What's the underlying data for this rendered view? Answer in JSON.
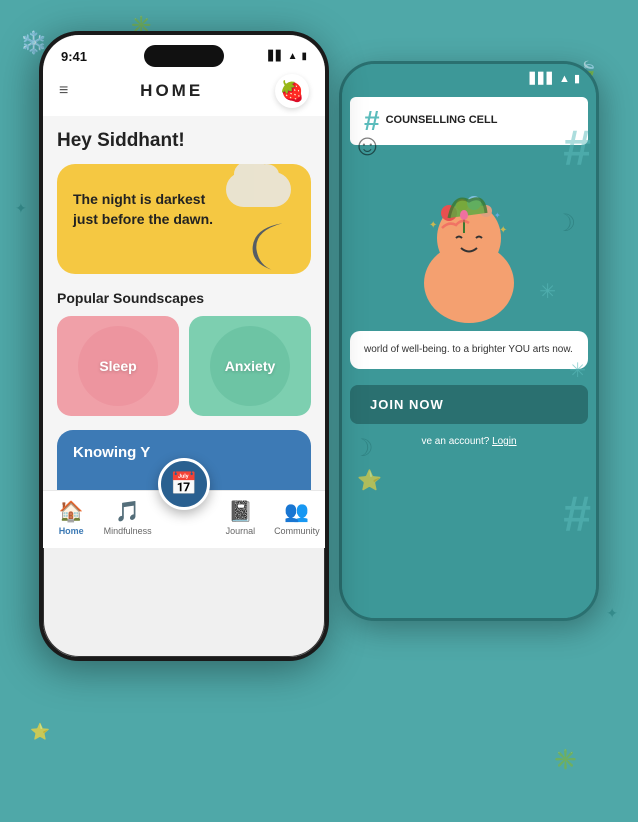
{
  "background_color": "#4fa8a8",
  "phone_front": {
    "status_bar": {
      "time": "9:41",
      "icons": [
        "signal",
        "wifi",
        "battery"
      ]
    },
    "header": {
      "title": "HOME",
      "menu_icon": "hamburger",
      "profile_icon": "🍓"
    },
    "greeting": "Hey Siddhant!",
    "quote_card": {
      "text": "The night is darkest just before the dawn.",
      "bg_color": "#f5c842"
    },
    "soundscapes": {
      "section_title": "Popular Soundscapes",
      "items": [
        {
          "label": "Sleep",
          "color": "#f0a0a8"
        },
        {
          "label": "Anxiety",
          "color": "#7dcfb0"
        }
      ]
    },
    "knowing_section": {
      "title": "Knowing Y"
    },
    "bottom_nav": {
      "items": [
        {
          "label": "Home",
          "icon": "🏠",
          "active": true
        },
        {
          "label": "Mindfulness",
          "icon": "🎵",
          "active": false
        },
        {
          "label": "",
          "icon": "📅",
          "active": false,
          "fab": true
        },
        {
          "label": "Journal",
          "icon": "📓",
          "active": false
        },
        {
          "label": "Community",
          "icon": "👥",
          "active": false
        }
      ]
    }
  },
  "phone_back": {
    "status_bar": {
      "icons": [
        "signal",
        "wifi",
        "battery"
      ]
    },
    "header": {
      "title": "COUNSELLING\nCELL"
    },
    "well_being_text": "world of well-being.\nto a brighter YOU\narts now.",
    "join_btn_label": "JOIN NOW",
    "login_text": "ve an account?",
    "login_link": "Login"
  }
}
